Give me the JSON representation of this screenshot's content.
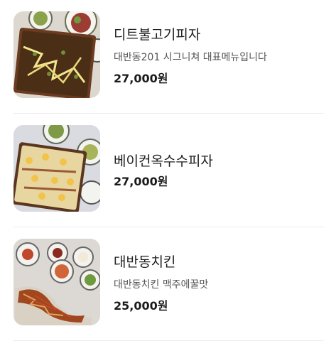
{
  "menu": {
    "items": [
      {
        "name": "디트불고기피자",
        "description": "대반동201 시그니쳐 대표메뉴입니다",
        "price": "27,000원",
        "image_icon": "bulgogi-pizza-photo"
      },
      {
        "name": "베이컨옥수수피자",
        "description": "",
        "price": "27,000원",
        "image_icon": "bacon-corn-pizza-photo"
      },
      {
        "name": "대반동치킨",
        "description": "대반동치킨 맥주에꿀맛",
        "price": "25,000원",
        "image_icon": "fried-chicken-photo"
      }
    ]
  }
}
